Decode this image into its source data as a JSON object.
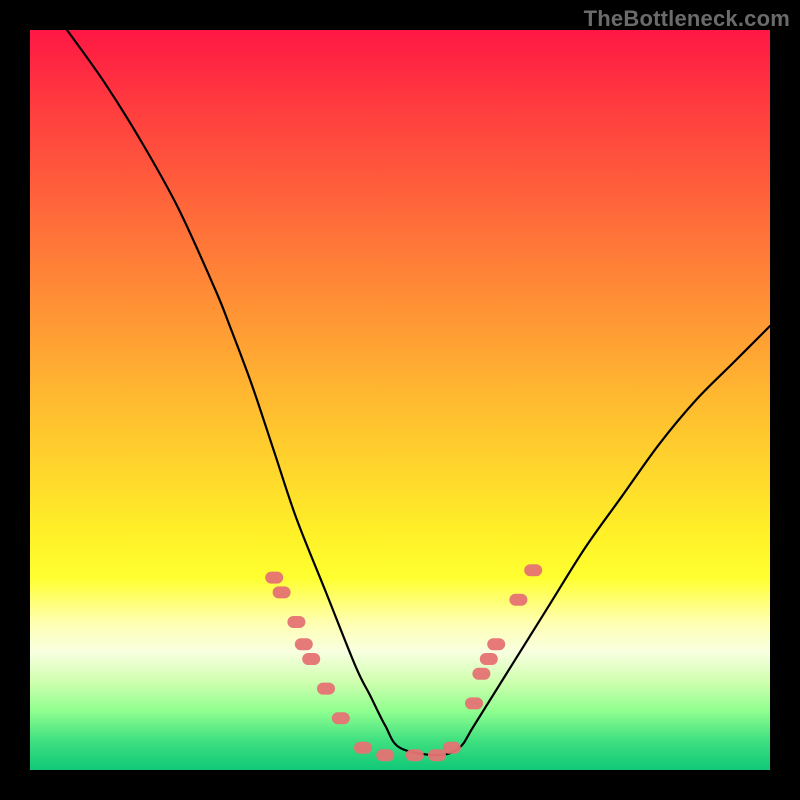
{
  "watermark": "TheBottleneck.com",
  "chart_data": {
    "type": "line",
    "title": "",
    "xlabel": "",
    "ylabel": "",
    "xlim": [
      0,
      100
    ],
    "ylim": [
      0,
      100
    ],
    "grid": false,
    "legend": false,
    "background_gradient": {
      "stops": [
        {
          "pos": 0,
          "color": "#ff1744"
        },
        {
          "pos": 50,
          "color": "#ffd82c"
        },
        {
          "pos": 74,
          "color": "#ffff30"
        },
        {
          "pos": 84,
          "color": "#f8ffe0"
        },
        {
          "pos": 100,
          "color": "#10c878"
        }
      ]
    },
    "series": [
      {
        "name": "bottleneck-curve",
        "style": "solid",
        "color": "#000000",
        "x": [
          5,
          10,
          15,
          20,
          25,
          27,
          30,
          33,
          36,
          40,
          44,
          46,
          48,
          50,
          55,
          58,
          60,
          65,
          70,
          75,
          80,
          85,
          90,
          95,
          100
        ],
        "y": [
          100,
          93,
          85,
          76,
          65,
          60,
          52,
          43,
          34,
          24,
          14,
          10,
          6,
          3,
          2,
          3,
          6,
          14,
          22,
          30,
          37,
          44,
          50,
          55,
          60
        ]
      }
    ],
    "markers": [
      {
        "name": "highlight-dots",
        "color": "#e57373",
        "shape": "pill",
        "points": [
          {
            "x": 33,
            "y": 26
          },
          {
            "x": 34,
            "y": 24
          },
          {
            "x": 36,
            "y": 20
          },
          {
            "x": 37,
            "y": 17
          },
          {
            "x": 38,
            "y": 15
          },
          {
            "x": 40,
            "y": 11
          },
          {
            "x": 42,
            "y": 7
          },
          {
            "x": 45,
            "y": 3
          },
          {
            "x": 48,
            "y": 2
          },
          {
            "x": 52,
            "y": 2
          },
          {
            "x": 55,
            "y": 2
          },
          {
            "x": 57,
            "y": 3
          },
          {
            "x": 60,
            "y": 9
          },
          {
            "x": 61,
            "y": 13
          },
          {
            "x": 62,
            "y": 15
          },
          {
            "x": 63,
            "y": 17
          },
          {
            "x": 66,
            "y": 23
          },
          {
            "x": 68,
            "y": 27
          }
        ]
      }
    ]
  }
}
